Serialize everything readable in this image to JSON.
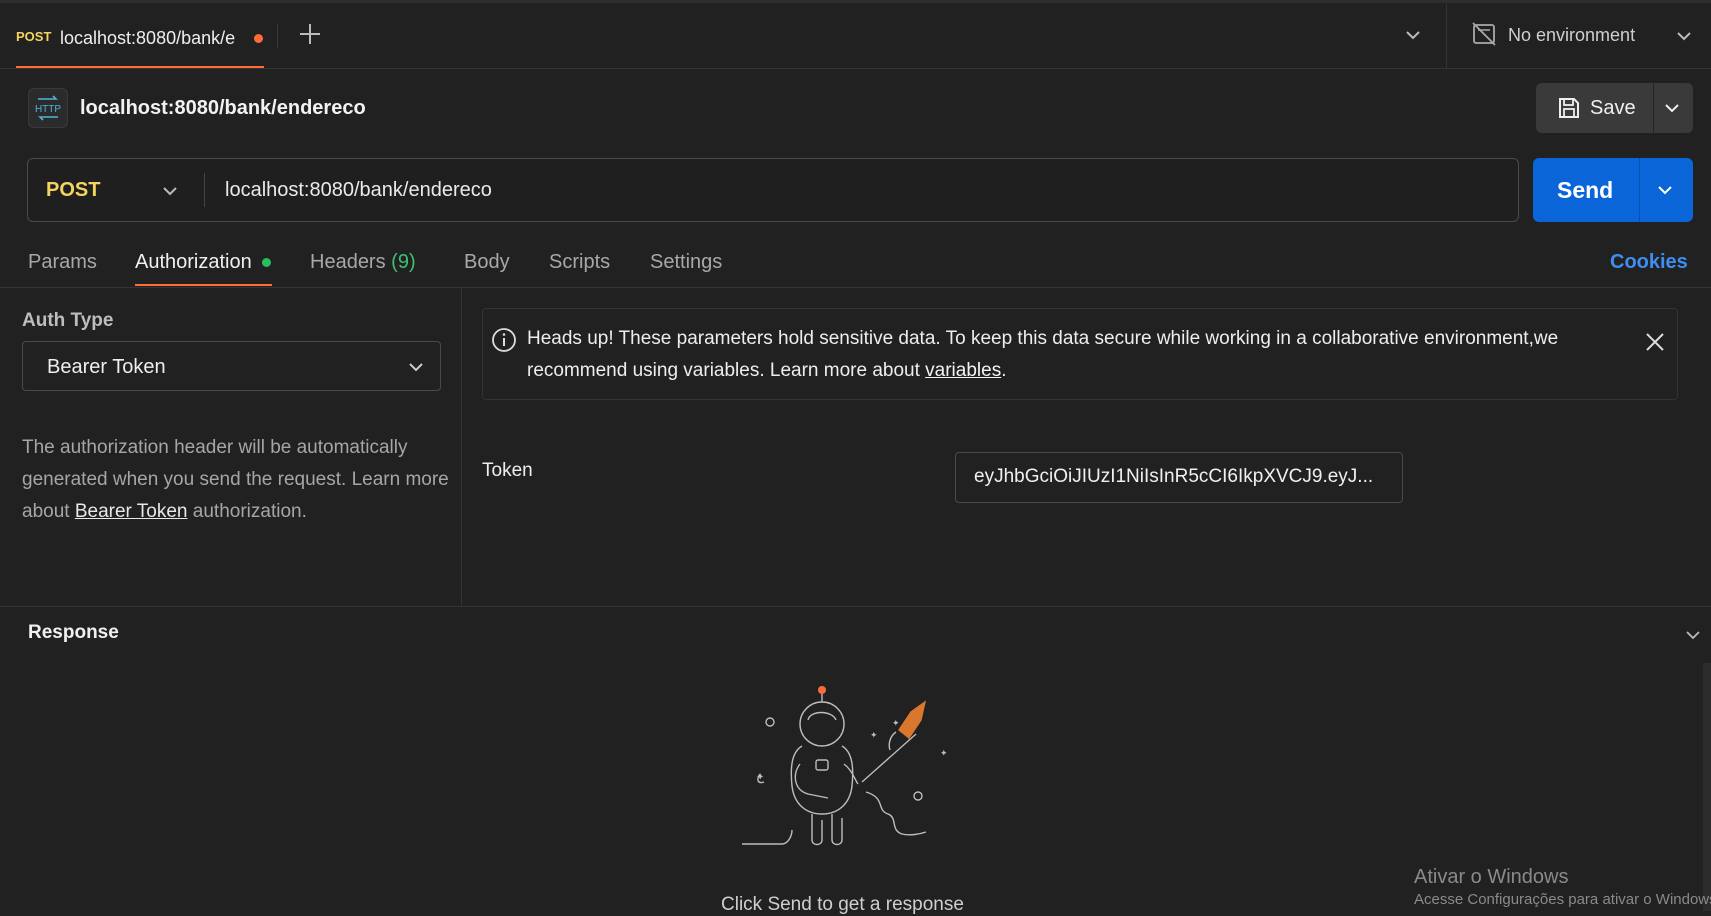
{
  "tabbar": {
    "tab_method": "POST",
    "tab_title": "localhost:8080/bank/e",
    "environment": "No environment"
  },
  "request": {
    "title": "localhost:8080/bank/endereco",
    "save_label": "Save",
    "method": "POST",
    "url": "localhost:8080/bank/endereco",
    "send_label": "Send"
  },
  "tabs": {
    "params": "Params",
    "authorization": "Authorization",
    "headers": "Headers",
    "headers_count": "(9)",
    "body": "Body",
    "scripts": "Scripts",
    "settings": "Settings",
    "cookies": "Cookies"
  },
  "auth": {
    "type_label": "Auth Type",
    "type_value": "Bearer Token",
    "desc_pre": "The authorization header will be automatically generated when you send the request. Learn more about ",
    "desc_link": "Bearer Token",
    "desc_post": " authorization.",
    "notice_pre": "Heads up! These parameters hold sensitive data. To keep this data secure while working in a collaborative environment,we recommend using variables. Learn more about ",
    "notice_link": "variables",
    "notice_post": ".",
    "token_label": "Token",
    "token_value": "eyJhbGciOiJIUzI1NiIsInR5cCI6IkpXVCJ9.eyJ..."
  },
  "response": {
    "title": "Response",
    "empty_message": "Click Send to get a response"
  },
  "watermark": {
    "line1": "Ativar o Windows",
    "line2": "Acesse Configurações para ativar o Windows."
  },
  "colors": {
    "accent": "#ff6c37",
    "send": "#0a66d8",
    "method": "#f4d35e",
    "link": "#3d8ef0",
    "success": "#2bbd5d"
  }
}
